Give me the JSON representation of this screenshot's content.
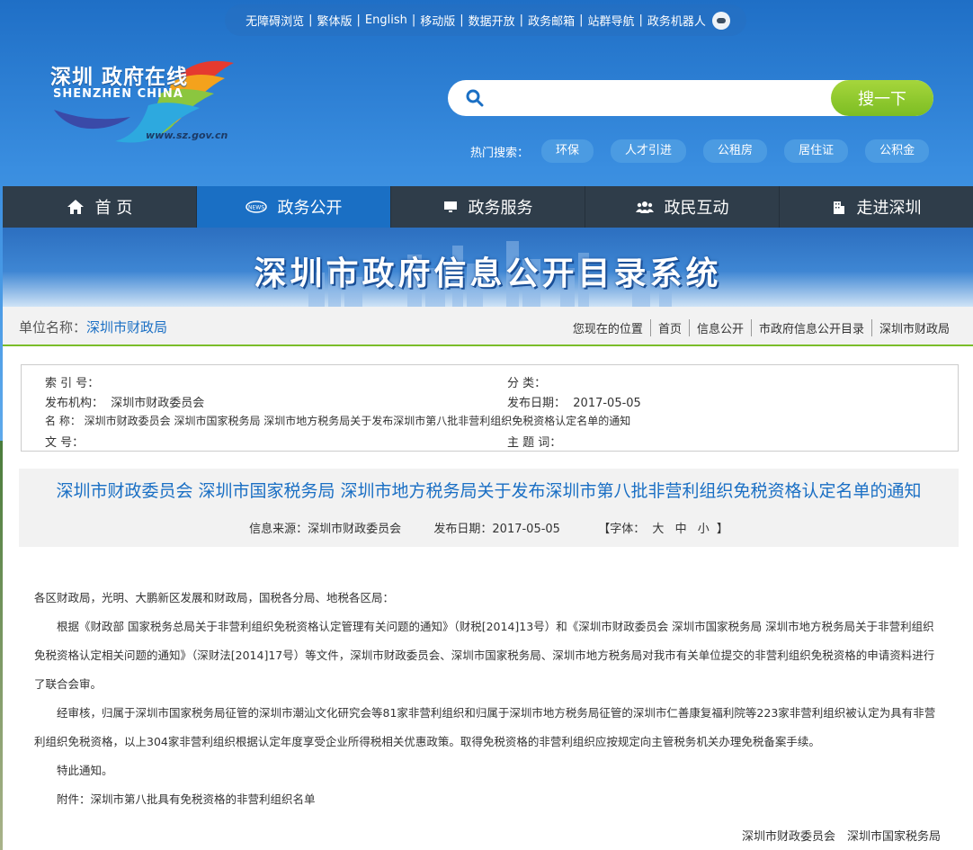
{
  "toplinks": [
    {
      "label": "无障碍浏览"
    },
    {
      "label": "繁体版"
    },
    {
      "label": "English"
    },
    {
      "label": "移动版"
    },
    {
      "label": "数据开放"
    },
    {
      "label": "政务邮箱"
    },
    {
      "label": "站群导航"
    },
    {
      "label": "政务机器人"
    }
  ],
  "logo": {
    "cn": "深圳 政府在线",
    "en": "SHENZHEN CHINA",
    "url": "www.sz.gov.cn"
  },
  "search": {
    "placeholder": "",
    "button": "搜一下"
  },
  "hot": {
    "label": "热门搜索：",
    "tags": [
      "环保",
      "人才引进",
      "公租房",
      "居住证",
      "公积金"
    ]
  },
  "nav": [
    {
      "label": "首 页",
      "icon": "home-icon"
    },
    {
      "label": "政务公开",
      "icon": "news-icon"
    },
    {
      "label": "政务服务",
      "icon": "monitor-icon"
    },
    {
      "label": "政民互动",
      "icon": "people-icon"
    },
    {
      "label": "走进深圳",
      "icon": "building-icon"
    }
  ],
  "banner": {
    "title": "深圳市政府信息公开目录系统"
  },
  "unit": {
    "label": "单位名称：",
    "name": "深圳市财政局"
  },
  "breadcrumb": [
    "您现在的位置",
    "首页",
    "信息公开",
    "市政府信息公开目录",
    "深圳市财政局"
  ],
  "meta": {
    "index_label": "索 引 号：",
    "index_value": "",
    "category_label": "分 类：",
    "category_value": "",
    "agency_label": "发布机构：",
    "agency_value": "深圳市财政委员会",
    "date_label": "发布日期：",
    "date_value": "2017-05-05",
    "name_label": "名 称：",
    "name_value": "深圳市财政委员会 深圳市国家税务局 深圳市地方税务局关于发布深圳市第八批非营利组织免税资格认定名单的通知",
    "docno_label": "文 号：",
    "docno_value": "",
    "keywords_label": "主 题 词：",
    "keywords_value": ""
  },
  "article": {
    "title": "深圳市财政委员会 深圳市国家税务局 深圳市地方税务局关于发布深圳市第八批非营利组织免税资格认定名单的通知",
    "source": "信息来源：深圳市财政委员会",
    "date": "发布日期：2017-05-05",
    "font_label": "【字体：",
    "font_large": "大",
    "font_medium": "中",
    "font_small": "小",
    "font_close": "】",
    "paragraphs": [
      "各区财政局，光明、大鹏新区发展和财政局，国税各分局、地税各区局：",
      "根据《财政部 国家税务总局关于非营利组织免税资格认定管理有关问题的通知》（财税[2014]13号）和《深圳市财政委员会 深圳市国家税务局 深圳市地方税务局关于非营利组织免税资格认定相关问题的通知》（深财法[2014]17号）等文件，深圳市财政委员会、深圳市国家税务局、深圳市地方税务局对我市有关单位提交的非营利组织免税资格的申请资料进行了联合会审。",
      "经审核，归属于深圳市国家税务局征管的深圳市潮汕文化研究会等81家非营利组织和归属于深圳市地方税务局征管的深圳市仁善康复福利院等223家非营利组织被认定为具有非营利组织免税资格，以上304家非营利组织根据认定年度享受企业所得税相关优惠政策。取得免税资格的非营利组织应按规定向主管税务机关办理免税备案手续。",
      "特此通知。",
      "附件：深圳市第八批具有免税资格的非营利组织名单"
    ],
    "signature": "深圳市财政委员会　深圳市国家税务局"
  }
}
